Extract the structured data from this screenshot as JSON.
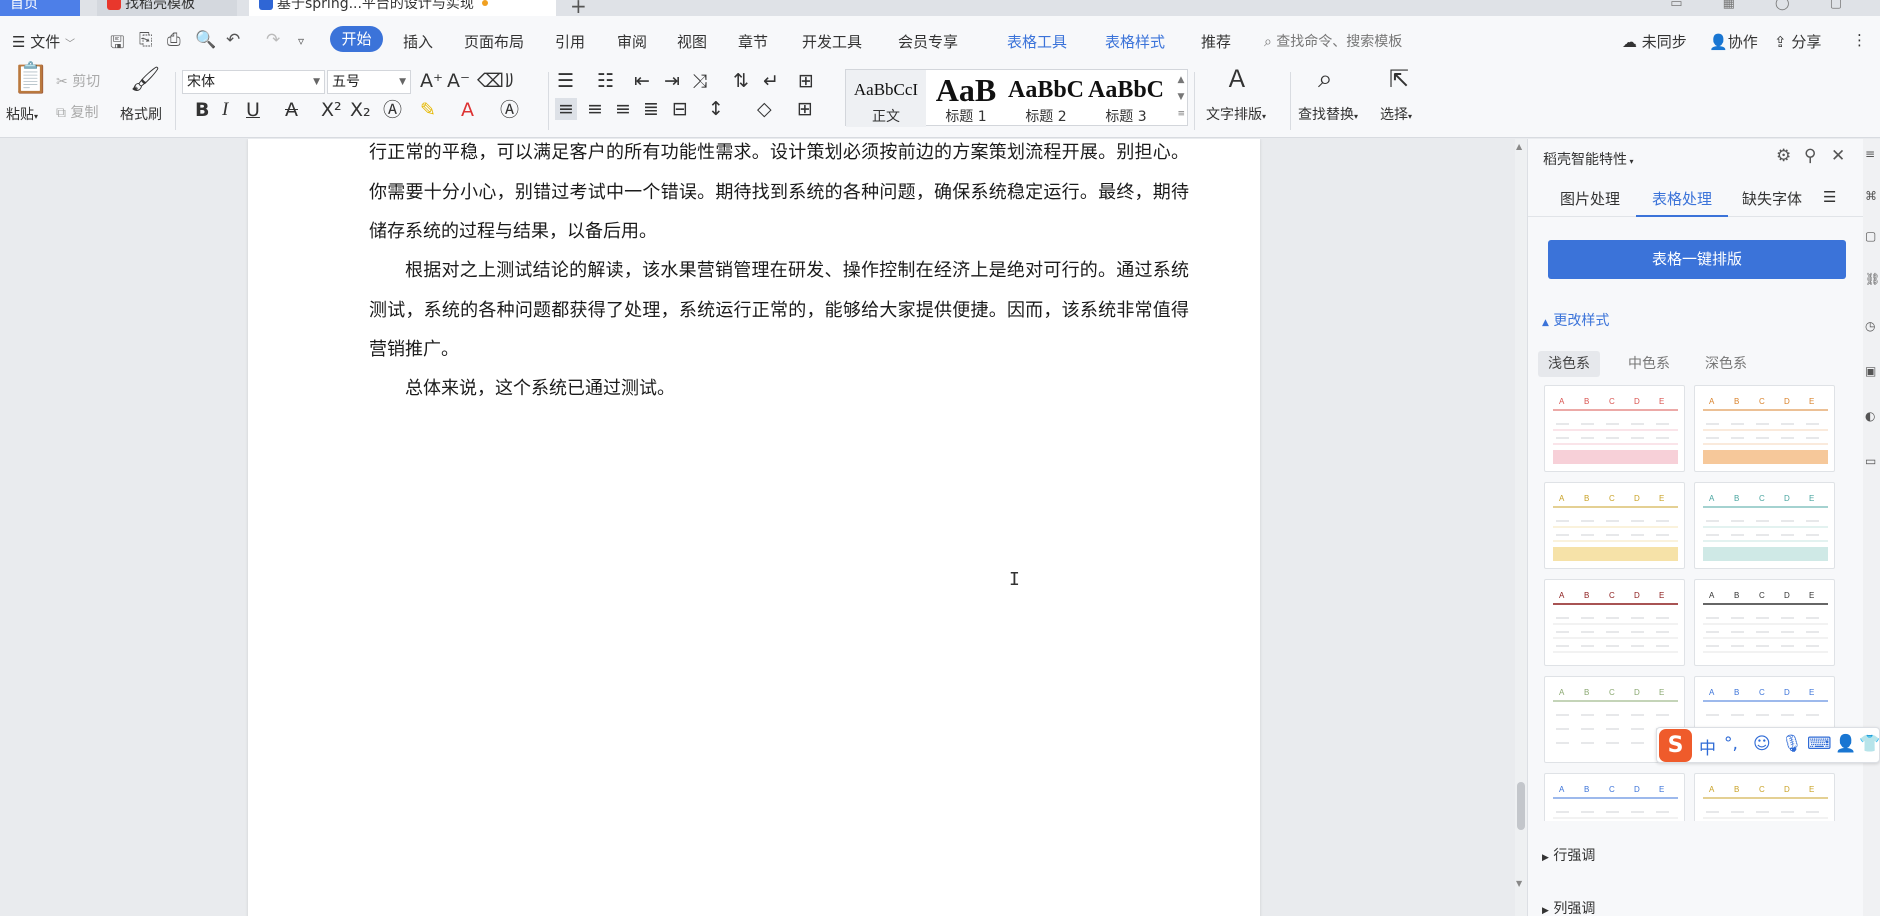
{
  "tabs": [
    {
      "label": "首页",
      "active": false
    },
    {
      "label": "找稻壳模板",
      "active": false
    },
    {
      "label": "基于spring...平台的设计与实现",
      "active": true
    }
  ],
  "menu": {
    "file": "文件",
    "items": [
      "开始",
      "插入",
      "页面布局",
      "引用",
      "审阅",
      "视图",
      "章节",
      "开发工具",
      "会员专享"
    ],
    "context_items": [
      "表格工具",
      "表格样式"
    ],
    "recommend": "推荐",
    "search_placeholder": "查找命令、搜索模板",
    "sync": "未同步",
    "collab": "协作",
    "share": "分享"
  },
  "ribbon": {
    "paste": "粘贴",
    "cut": "剪切",
    "copy": "复制",
    "format_painter": "格式刷",
    "font_name": "宋体",
    "font_size": "五号",
    "styles": [
      {
        "sample": "AaBbCcI",
        "label": "正文"
      },
      {
        "sample": "AaB",
        "label": "标题 1"
      },
      {
        "sample": "AaBbC",
        "label": "标题 2"
      },
      {
        "sample": "AaBbC",
        "label": "标题 3"
      }
    ],
    "text_layout": "文字排版",
    "find_replace": "查找替换",
    "select": "选择"
  },
  "document": {
    "paragraphs": [
      "行正常的平稳，可以满足客户的所有功能性需求。设计策划必须按前边的方案策划流程开展。别担心。你需要十分小心，别错过考试中一个错误。期待找到系统的各种问题，确保系统稳定运行。最终，期待储存系统的过程与结果，以备后用。",
      "根据对之上测试结论的解读，该水果营销管理在研发、操作控制在经济上是绝对可行的。通过系统测试，系统的各种问题都获得了处理，系统运行正常的，能够给大家提供便捷。因而，该系统非常值得营销推广。",
      "总体来说，这个系统已通过测试。"
    ]
  },
  "panel": {
    "title": "稻壳智能特性",
    "tabs": [
      "图片处理",
      "表格处理",
      "缺失字体"
    ],
    "active_tab": "表格处理",
    "primary_button": "表格一键排版",
    "change_style": "更改样式",
    "color_filters": [
      "浅色系",
      "中色系",
      "深色系"
    ],
    "row_emphasis": "行强调",
    "col_emphasis": "列强调",
    "thumb_headers": [
      "A",
      "B",
      "C",
      "D",
      "E"
    ]
  },
  "ime": {
    "lang": "中",
    "punct": "°,"
  },
  "colors": {
    "accent": "#3b73d9"
  }
}
